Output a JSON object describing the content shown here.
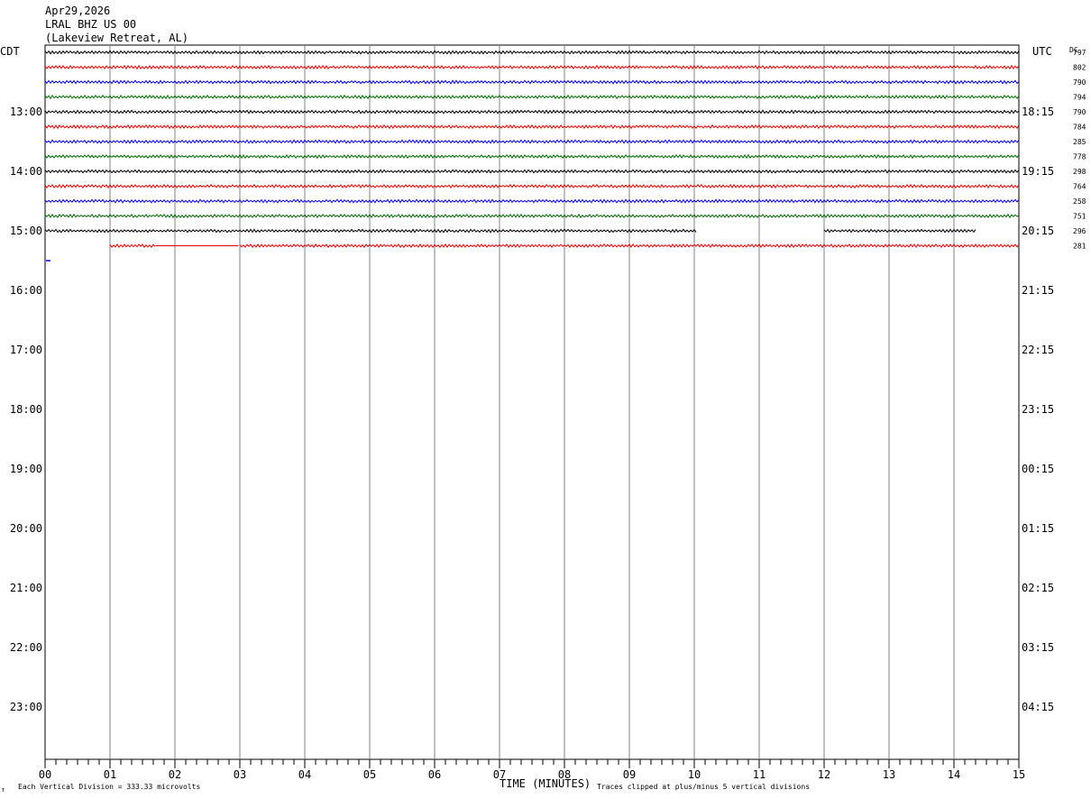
{
  "header": {
    "date": "Apr29,2026",
    "station": "LRAL BHZ US 00",
    "location": "(Lakeview Retreat, AL)"
  },
  "left_axis_label": "CDT",
  "right_axis_label": "UTC",
  "dc_label": "DC",
  "footer": {
    "corner_mark": "↑",
    "division_note": "Each Vertical Division =  333.33 microvolts",
    "xlabel": "TIME (MINUTES)",
    "clip_note": "Traces clipped at plus/minus 5 vertical divisions"
  },
  "colors": {
    "black": "#000000",
    "red": "#dd0000",
    "blue": "#0000dd",
    "green": "#006600",
    "grid": "#808080"
  },
  "chart_data": {
    "type": "line",
    "title": "LRAL BHZ US 00",
    "xlabel": "TIME (MINUTES)",
    "x_ticks": [
      "00",
      "01",
      "02",
      "03",
      "04",
      "05",
      "06",
      "07",
      "08",
      "09",
      "10",
      "11",
      "12",
      "13",
      "14",
      "15"
    ],
    "xlim": [
      0,
      15
    ],
    "left_hour_labels": [
      "13:00",
      "14:00",
      "15:00",
      "16:00",
      "17:00",
      "18:00",
      "19:00",
      "20:00",
      "21:00",
      "22:00",
      "23:00"
    ],
    "right_hour_labels": [
      "18:15",
      "19:15",
      "20:15",
      "21:15",
      "22:15",
      "23:15",
      "00:15",
      "01:15",
      "02:15",
      "03:15",
      "04:15"
    ],
    "total_rows": 48,
    "first_labeled_row": 4,
    "color_cycle": [
      "black",
      "red",
      "blue",
      "green"
    ],
    "traces": [
      {
        "row": 0,
        "color": "black",
        "dc": "797",
        "segments": [
          [
            0,
            15
          ]
        ]
      },
      {
        "row": 1,
        "color": "red",
        "dc": "802",
        "segments": [
          [
            0,
            15
          ]
        ]
      },
      {
        "row": 2,
        "color": "blue",
        "dc": "790",
        "segments": [
          [
            0,
            15
          ]
        ]
      },
      {
        "row": 3,
        "color": "green",
        "dc": "794",
        "segments": [
          [
            0,
            15
          ]
        ]
      },
      {
        "row": 4,
        "color": "black",
        "dc": "790",
        "segments": [
          [
            0,
            15
          ]
        ]
      },
      {
        "row": 5,
        "color": "red",
        "dc": "784",
        "segments": [
          [
            0,
            15
          ]
        ]
      },
      {
        "row": 6,
        "color": "blue",
        "dc": "285",
        "segments": [
          [
            0,
            15
          ]
        ]
      },
      {
        "row": 7,
        "color": "green",
        "dc": "778",
        "segments": [
          [
            0,
            15
          ]
        ]
      },
      {
        "row": 8,
        "color": "black",
        "dc": "298",
        "segments": [
          [
            0,
            15
          ]
        ]
      },
      {
        "row": 9,
        "color": "red",
        "dc": "764",
        "segments": [
          [
            0,
            15
          ]
        ]
      },
      {
        "row": 10,
        "color": "blue",
        "dc": "258",
        "segments": [
          [
            0,
            15
          ]
        ]
      },
      {
        "row": 11,
        "color": "green",
        "dc": "751",
        "segments": [
          [
            0,
            15
          ]
        ]
      },
      {
        "row": 12,
        "color": "black",
        "dc": "296",
        "segments": [
          [
            0,
            10.05
          ],
          [
            12.0,
            14.35
          ]
        ]
      },
      {
        "row": 13,
        "color": "red",
        "dc": "281",
        "segments": [
          [
            1.0,
            1.7
          ],
          [
            1.7,
            3.0
          ],
          [
            3.0,
            15
          ]
        ]
      }
    ]
  }
}
